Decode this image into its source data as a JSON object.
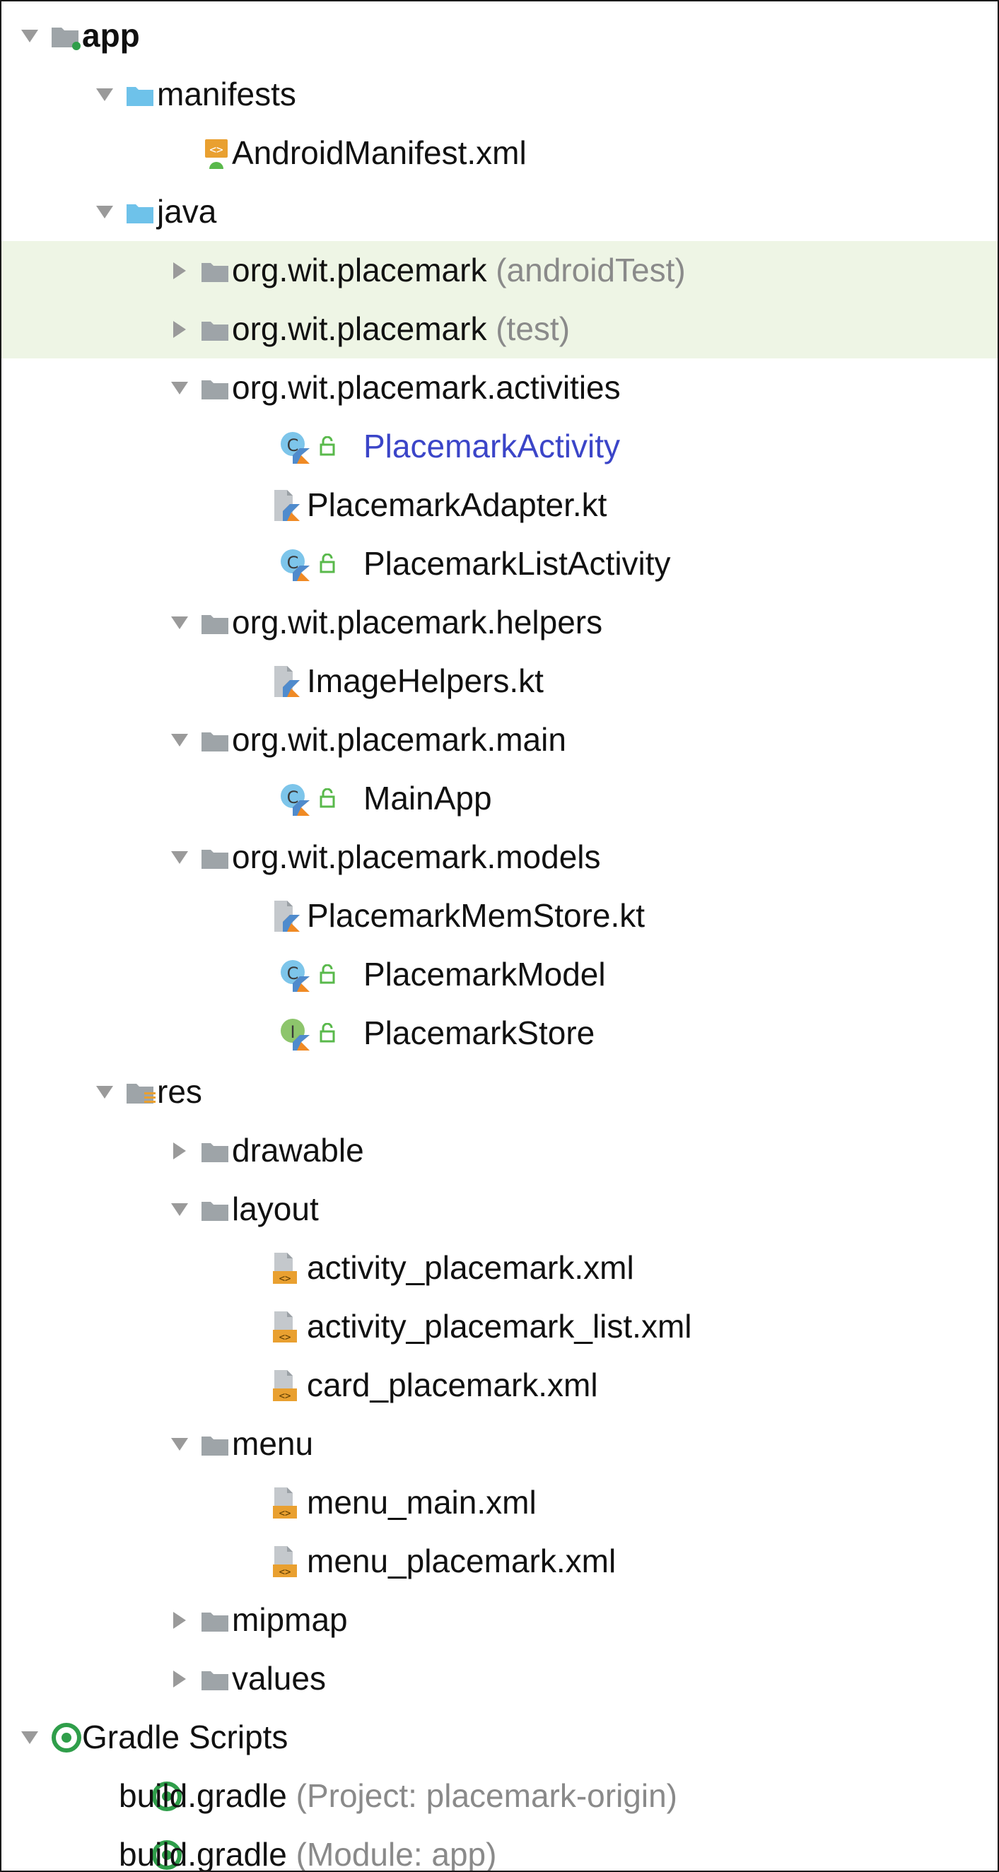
{
  "tree": {
    "rows": [
      {
        "kind": "module",
        "depth": 0,
        "arrow": "down",
        "label": "app",
        "bold": true
      },
      {
        "kind": "folder-blue",
        "depth": 1,
        "arrow": "down",
        "label": "manifests"
      },
      {
        "kind": "manifest-file",
        "depth": 2,
        "arrow": "none",
        "label": "AndroidManifest.xml"
      },
      {
        "kind": "folder-blue",
        "depth": 1,
        "arrow": "down",
        "label": "java"
      },
      {
        "kind": "package",
        "depth": 2,
        "arrow": "right",
        "label": "org.wit.placemark",
        "hint": "(androidTest)",
        "highlight": true
      },
      {
        "kind": "package",
        "depth": 2,
        "arrow": "right",
        "label": "org.wit.placemark",
        "hint": "(test)",
        "highlight": true
      },
      {
        "kind": "package",
        "depth": 2,
        "arrow": "down",
        "label": "org.wit.placemark.activities"
      },
      {
        "kind": "kotlin-class",
        "depth": 3,
        "arrow": "none",
        "label": "PlacemarkActivity",
        "blue": true
      },
      {
        "kind": "kotlin-file",
        "depth": 3,
        "arrow": "none",
        "label": "PlacemarkAdapter.kt"
      },
      {
        "kind": "kotlin-class",
        "depth": 3,
        "arrow": "none",
        "label": "PlacemarkListActivity"
      },
      {
        "kind": "package",
        "depth": 2,
        "arrow": "down",
        "label": "org.wit.placemark.helpers"
      },
      {
        "kind": "kotlin-file",
        "depth": 3,
        "arrow": "none",
        "label": "ImageHelpers.kt"
      },
      {
        "kind": "package",
        "depth": 2,
        "arrow": "down",
        "label": "org.wit.placemark.main"
      },
      {
        "kind": "kotlin-class",
        "depth": 3,
        "arrow": "none",
        "label": "MainApp"
      },
      {
        "kind": "package",
        "depth": 2,
        "arrow": "down",
        "label": "org.wit.placemark.models"
      },
      {
        "kind": "kotlin-file",
        "depth": 3,
        "arrow": "none",
        "label": "PlacemarkMemStore.kt"
      },
      {
        "kind": "kotlin-class",
        "depth": 3,
        "arrow": "none",
        "label": "PlacemarkModel"
      },
      {
        "kind": "kotlin-interface",
        "depth": 3,
        "arrow": "none",
        "label": "PlacemarkStore"
      },
      {
        "kind": "res-folder",
        "depth": 1,
        "arrow": "down",
        "label": "res"
      },
      {
        "kind": "package",
        "depth": 2,
        "arrow": "right",
        "label": "drawable"
      },
      {
        "kind": "package",
        "depth": 2,
        "arrow": "down",
        "label": "layout"
      },
      {
        "kind": "xml-file",
        "depth": 3,
        "arrow": "none",
        "label": "activity_placemark.xml"
      },
      {
        "kind": "xml-file",
        "depth": 3,
        "arrow": "none",
        "label": "activity_placemark_list.xml"
      },
      {
        "kind": "xml-file",
        "depth": 3,
        "arrow": "none",
        "label": "card_placemark.xml"
      },
      {
        "kind": "package",
        "depth": 2,
        "arrow": "down",
        "label": "menu"
      },
      {
        "kind": "xml-file",
        "depth": 3,
        "arrow": "none",
        "label": "menu_main.xml"
      },
      {
        "kind": "xml-file",
        "depth": 3,
        "arrow": "none",
        "label": "menu_placemark.xml"
      },
      {
        "kind": "package",
        "depth": 2,
        "arrow": "right",
        "label": "mipmap"
      },
      {
        "kind": "package",
        "depth": 2,
        "arrow": "right",
        "label": "values"
      },
      {
        "kind": "gradle-root",
        "depth": 0,
        "arrow": "down",
        "label": "Gradle Scripts"
      },
      {
        "kind": "gradle-file",
        "depth": 1,
        "arrow": "none",
        "label": "build.gradle",
        "hint": "(Project: placemark-origin)"
      },
      {
        "kind": "gradle-file",
        "depth": 1,
        "arrow": "none",
        "label": "build.gradle",
        "hint": "(Module: app)"
      }
    ]
  },
  "colors": {
    "selection_highlight": "#eef5e5",
    "folder_blue": "#6fc2ea",
    "folder_gray": "#9ea4a8",
    "kotlin_orange": "#f08a24",
    "kotlin_blue": "#3d8be0",
    "class_badge": "#7dc5ea",
    "interface_badge": "#8dc56c",
    "access_green": "#59b94b",
    "gradle_green": "#2f9e4a",
    "xml_orange": "#e9a030",
    "active_class_text": "#3b45c8",
    "hint_text": "#8a8a8a"
  }
}
